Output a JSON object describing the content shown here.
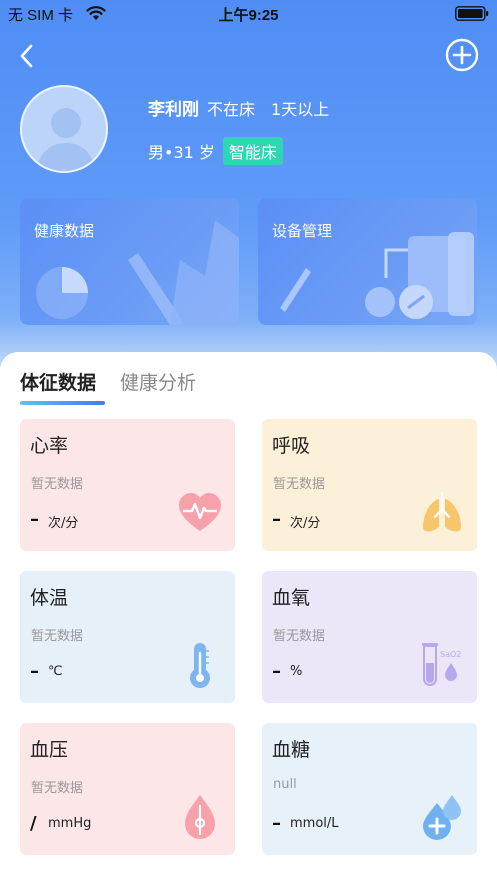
{
  "status_bar": {
    "carrier": "无 SIM 卡",
    "time": "上午9:25"
  },
  "profile": {
    "name": "李利刚",
    "bed_status": "不在床",
    "duration": "1天以上",
    "gender_age": "男•31 岁",
    "bed_type": "智能床"
  },
  "top_cards": {
    "health_label": "健康数据",
    "device_label": "设备管理"
  },
  "tabs": {
    "vitals": "体征数据",
    "analysis": "健康分析"
  },
  "metrics": [
    {
      "title": "心率",
      "status": "暂无数据",
      "value": "–",
      "unit": "次/分",
      "icon": "heart-icon"
    },
    {
      "title": "呼吸",
      "status": "暂无数据",
      "value": "–",
      "unit": "次/分",
      "icon": "lungs-icon"
    },
    {
      "title": "体温",
      "status": "暂无数据",
      "value": "–",
      "unit": "℃",
      "icon": "thermometer-icon"
    },
    {
      "title": "血氧",
      "status": "暂无数据",
      "value": "–",
      "unit": "%",
      "icon": "test-tube-icon"
    },
    {
      "title": "血压",
      "status": "暂无数据",
      "value": "/",
      "unit": "mmHg",
      "icon": "blood-drop-icon"
    },
    {
      "title": "血糖",
      "status": "null",
      "value": "–",
      "unit": "mmol/L",
      "icon": "glucose-drop-icon"
    }
  ],
  "icon_labels": {
    "sao2": "SaO2"
  },
  "colors": {
    "header_blue": "#4f8df5",
    "tag_green": "#2ed6b3",
    "heart_pink": "#f7a1aa",
    "lungs_orange": "#f8c66a",
    "thermo_blue": "#7fb5ee",
    "tube_purple": "#b9a7ee"
  }
}
